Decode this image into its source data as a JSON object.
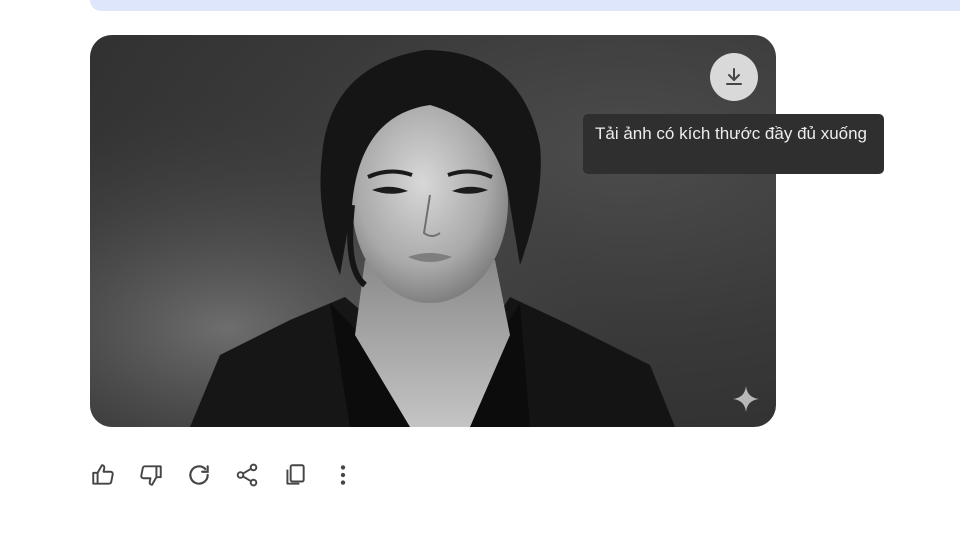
{
  "tooltip": {
    "text": "Tải ảnh có kích thước đầy đủ xuống"
  },
  "download_button": {
    "icon": "download-icon",
    "label": "Tải ảnh có kích thước đầy đủ xuống"
  },
  "image": {
    "alt": "Generated black and white portrait",
    "watermark_icon": "sparkle-icon"
  },
  "actions": [
    {
      "icon": "thumb-up-icon"
    },
    {
      "icon": "thumb-down-icon"
    },
    {
      "icon": "regenerate-icon"
    },
    {
      "icon": "share-icon"
    },
    {
      "icon": "copy-icon"
    },
    {
      "icon": "more-vert-icon"
    }
  ],
  "colors": {
    "prompt_strip": "#dde6fb",
    "tooltip_bg": "#2f2f2f",
    "icon": "#444746"
  }
}
